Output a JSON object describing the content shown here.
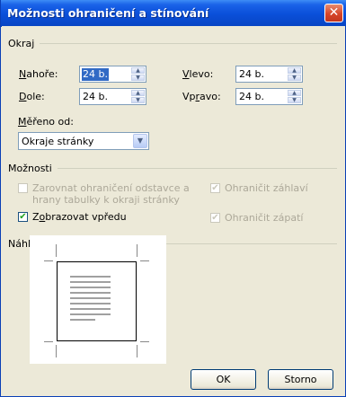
{
  "window": {
    "title": "Možnosti ohraničení a stínování",
    "close_glyph": "✕"
  },
  "okraj": {
    "label": "Okraj",
    "nahore": {
      "label_underlined": "N",
      "label_rest": "ahoře:",
      "value": "24 b."
    },
    "dole": {
      "label_underlined": "D",
      "label_rest": "ole:",
      "value": "24 b."
    },
    "vlevo": {
      "label_underlined": "V",
      "label_rest": "levo:",
      "value": "24 b."
    },
    "vpravo": {
      "label_pre": "Vp",
      "label_underlined": "r",
      "label_rest": "avo:",
      "value": "24 b."
    },
    "mereno_od": {
      "label_underlined": "M",
      "label_rest": "ěřeno od:",
      "value": "Okraje stránky"
    }
  },
  "moznosti": {
    "label": "Možnosti",
    "zarovnat": {
      "line1": "Zarovnat ohraničení odstavce a",
      "line2": "hrany tabulky k okraji stránky",
      "checked": false,
      "enabled": false
    },
    "zobrazovat": {
      "label_pre": "Z",
      "label_underlined": "o",
      "label_rest": "brazovat vpředu",
      "checked": true,
      "enabled": true
    },
    "zahlavi": {
      "label": "Ohraničit záhlaví",
      "checked": true,
      "enabled": false
    },
    "zapati": {
      "label": "Ohraničit zápatí",
      "checked": true,
      "enabled": false
    }
  },
  "nahled": {
    "label": "Náhled"
  },
  "buttons": {
    "ok": "OK",
    "storno": "Storno"
  },
  "icons": {
    "spin_up": "▲",
    "spin_down": "▼",
    "dropdown": "▼",
    "check": "✔"
  }
}
